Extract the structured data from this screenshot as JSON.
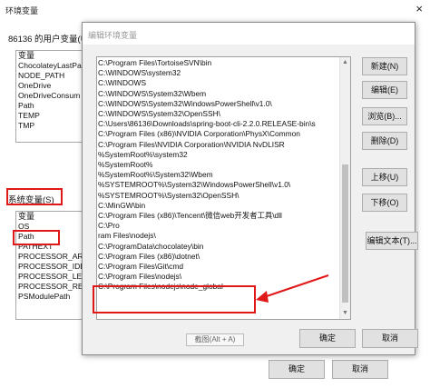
{
  "back_window": {
    "title": "环境变量",
    "close_glyph": "×",
    "user_vars_heading": "86136 的用户变量(U",
    "user_list_header": "变量",
    "user_vars": [
      "ChocolateyLastPat",
      "NODE_PATH",
      "OneDrive",
      "OneDriveConsum",
      "Path",
      "TEMP",
      "TMP"
    ],
    "sys_vars_heading": "系统变量(S)",
    "sys_list_header": "变量",
    "sys_vars": [
      "OS",
      "Path",
      "PATHEXT",
      "PROCESSOR_ARC",
      "PROCESSOR_IDEN",
      "PROCESSOR_LEVI",
      "PROCESSOR_REV",
      "PSModulePath"
    ],
    "ok_label": "确定",
    "cancel_label": "取消"
  },
  "dialog": {
    "title": "编辑环境变量",
    "paths": [
      "C:\\Program Files\\TortoiseSVN\\bin",
      "C:\\WINDOWS\\system32",
      "C:\\WINDOWS",
      "C:\\WINDOWS\\System32\\Wbem",
      "C:\\WINDOWS\\System32\\WindowsPowerShell\\v1.0\\",
      "C:\\WINDOWS\\System32\\OpenSSH\\",
      "C:\\Users\\86136\\Downloads\\spring-boot-cli-2.2.0.RELEASE-bin\\s",
      "C:\\Program Files (x86)\\NVIDIA Corporation\\PhysX\\Common",
      "C:\\Program Files\\NVIDIA Corporation\\NVIDIA NvDLISR",
      "%SystemRoot%\\system32",
      "%SystemRoot%",
      "%SystemRoot%\\System32\\Wbem",
      "%SYSTEMROOT%\\System32\\WindowsPowerShell\\v1.0\\",
      "%SYSTEMROOT%\\System32\\OpenSSH\\",
      "C:\\MinGW\\bin",
      "C:\\Program Files (x86)\\Tencent\\微信web开发者工具\\dll",
      "C:\\Pro",
      "ram Files\\nodejs\\",
      "C:\\ProgramData\\chocolatey\\bin",
      "C:\\Program Files (x86)\\dotnet\\",
      "C:\\Program Files\\Git\\cmd",
      "C:\\Program Files\\nodejs\\",
      "C:\\Program Files\\nodejs\\node_global"
    ],
    "buttons": {
      "new": "新建(N)",
      "edit": "编辑(E)",
      "browse": "浏览(B)...",
      "delete": "删除(D)",
      "move_up": "上移(U)",
      "move_down": "下移(O)",
      "edit_text": "编辑文本(T)...",
      "ok": "确定",
      "cancel": "取消"
    },
    "screenshot_tip": "截图(Alt + A)"
  },
  "colors": {
    "highlight_red": "#e01818"
  },
  "icons": {
    "scroll_up": "▲",
    "scroll_down": "▼"
  }
}
